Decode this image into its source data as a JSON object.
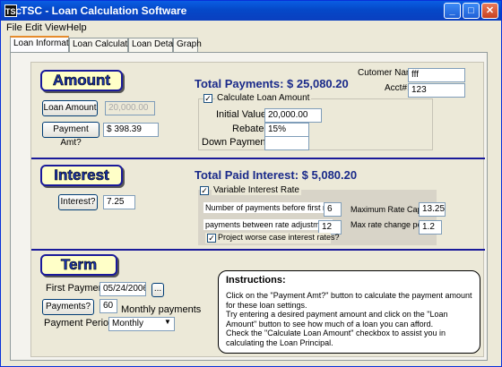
{
  "window": {
    "title": "TSC - Loan Calculation Software",
    "icon": "TSC"
  },
  "menu": [
    "File",
    "Edit",
    "View",
    "Help"
  ],
  "tabs": [
    "Loan Information",
    "Loan Calculation",
    "Loan Details",
    "Graph"
  ],
  "amount": {
    "header": "Amount",
    "loan_amount_button": "Loan Amount",
    "loan_amount_value": "20,000.00",
    "payment_amt_button": "Payment Amt?",
    "payment_amt_value": "$ 398.39",
    "total_payments": "Total Payments: $ 25,080.20",
    "customer_name_label": "Cutomer Name:",
    "customer_name_value": "fff",
    "acct_label": "Acct#:",
    "acct_value": "123",
    "calc_checkbox_label": "Calculate Loan Amount",
    "initial_value_label": "Initial Value",
    "initial_value": "20,000.00",
    "rebates_label": "Rebates",
    "rebates_value": "15%",
    "down_payment_label": "Down Payment",
    "down_payment_value": ""
  },
  "interest": {
    "header": "Interest",
    "interest_button": "Interest?",
    "interest_value": "7.25",
    "total_paid_interest": "Total Paid Interest: $ 5,080.20",
    "variable_rate_label": "Variable Interest Rate",
    "num_payments_label": "Number of payments before first rate",
    "num_payments_value": "6",
    "max_rate_cap_label": "Maximum Rate Cap",
    "max_rate_cap_value": "13.25",
    "payments_between_label": "payments between rate adjustment",
    "payments_between_value": "12",
    "max_rate_change_label": "Max rate change per",
    "max_rate_change_value": "1.2",
    "worse_case_label": "Project worse case interest rates?"
  },
  "term": {
    "header": "Term",
    "first_payment_label": "First Payment",
    "first_payment_value": "05/24/2006",
    "ellipsis_button": "...",
    "payments_button": "Payments?",
    "payments_value": "60",
    "monthly_payments_label": "Monthly payments",
    "payment_period_label": "Payment Period",
    "payment_period_value": "Monthly"
  },
  "instructions": {
    "title": "Instructions:",
    "body": "Click on the \"Payment Amt?\" button to calculate the payment amount for these loan settings.\nTry entering a desired payment amount and click on the \"Loan Amount\" button to see how much of a loan you can afford.\nCheck the \"Calculate Loan Amount\" checkbox to assist you in calculating the Loan Principal."
  },
  "colors": {
    "title_bar": "#0548c8",
    "header_fill": "#ffffc8",
    "header_text": "#1a35b0",
    "separator": "#1a1a9a"
  }
}
